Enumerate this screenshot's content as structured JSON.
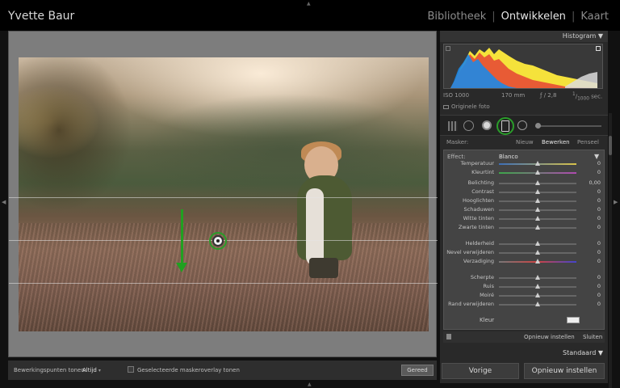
{
  "header": {
    "owner": "Yvette Baur",
    "modules": [
      "Bibliotheek",
      "Ontwikkelen",
      "Kaart"
    ],
    "separator": "|",
    "active_module": "Ontwikkelen"
  },
  "histogram": {
    "title": "Histogram",
    "iso": "ISO 1000",
    "focal": "170 mm",
    "aperture": "ƒ / 2,8",
    "shutter_num": "1",
    "shutter_den": "1000",
    "shutter_unit": "sec.",
    "original": "Originele foto"
  },
  "mask": {
    "label": "Masker:",
    "new": "Nieuw",
    "edit": "Bewerken",
    "brush": "Penseel"
  },
  "effect": {
    "label": "Effect:",
    "value": "Blanco"
  },
  "sliders": [
    {
      "label": "Temperatuur",
      "value": "0",
      "pos": 0.5
    },
    {
      "label": "Kleurtint",
      "value": "0",
      "pos": 0.5
    },
    {
      "label": "Belichting",
      "value": "0,00",
      "pos": 0.5
    },
    {
      "label": "Contrast",
      "value": "0",
      "pos": 0.5
    },
    {
      "label": "Hooglichten",
      "value": "0",
      "pos": 0.5
    },
    {
      "label": "Schaduwen",
      "value": "0",
      "pos": 0.5
    },
    {
      "label": "Witte tinten",
      "value": "0",
      "pos": 0.5
    },
    {
      "label": "Zwarte tinten",
      "value": "0",
      "pos": 0.5
    },
    {
      "label": "Helderheid",
      "value": "0",
      "pos": 0.5
    },
    {
      "label": "Nevel verwijderen",
      "value": "0",
      "pos": 0.5
    },
    {
      "label": "Verzadiging",
      "value": "0",
      "pos": 0.5
    },
    {
      "label": "Scherpte",
      "value": "0",
      "pos": 0.5
    },
    {
      "label": "Ruis",
      "value": "0",
      "pos": 0.5
    },
    {
      "label": "Moiré",
      "value": "0",
      "pos": 0.5
    },
    {
      "label": "Rand verwijderen",
      "value": "0",
      "pos": 0.5
    }
  ],
  "kleur": {
    "label": "Kleur"
  },
  "panel_actions": {
    "reset": "Opnieuw instellen",
    "close": "Sluiten"
  },
  "preset": {
    "label": "Standaard"
  },
  "buttons": {
    "previous": "Vorige",
    "reset": "Opnieuw instellen"
  },
  "toolbar": {
    "points_label": "Bewerkingspunten tonen:",
    "points_value": "Altijd",
    "overlay_label": "Geselecteerde maskeroverlay tonen",
    "done": "Gereed"
  },
  "colors": {
    "accent": "#2a9d2a",
    "background": "#111111"
  }
}
